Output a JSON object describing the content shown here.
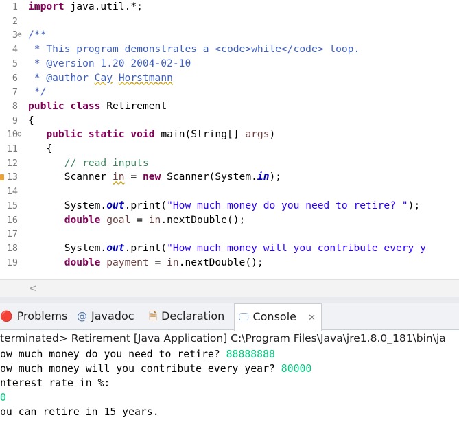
{
  "editor": {
    "lines": [
      {
        "n": "1",
        "fold": "",
        "segs": [
          {
            "t": "import",
            "c": "kw"
          },
          {
            "t": " java.util.*;"
          }
        ]
      },
      {
        "n": "2",
        "fold": "",
        "segs": []
      },
      {
        "n": "3",
        "fold": "⊖",
        "segs": [
          {
            "t": "/**",
            "c": "cm"
          }
        ]
      },
      {
        "n": "4",
        "fold": "",
        "segs": [
          {
            "t": " * This program demonstrates a <code>while</code> loop.",
            "c": "cm"
          }
        ]
      },
      {
        "n": "5",
        "fold": "",
        "segs": [
          {
            "t": " * @version 1.20 2004-02-10",
            "c": "cm"
          }
        ]
      },
      {
        "n": "6",
        "fold": "",
        "segs": [
          {
            "t": " * @author ",
            "c": "cm"
          },
          {
            "t": "Cay",
            "c": "cm sq"
          },
          {
            "t": " ",
            "c": "cm"
          },
          {
            "t": "Horstmann",
            "c": "cm sq"
          }
        ]
      },
      {
        "n": "7",
        "fold": "",
        "segs": [
          {
            "t": " */",
            "c": "cm"
          }
        ]
      },
      {
        "n": "8",
        "fold": "",
        "segs": [
          {
            "t": "public",
            "c": "kw"
          },
          {
            "t": " "
          },
          {
            "t": "class",
            "c": "kw"
          },
          {
            "t": " Retirement"
          }
        ]
      },
      {
        "n": "9",
        "fold": "",
        "segs": [
          {
            "t": "{"
          }
        ]
      },
      {
        "n": "10",
        "fold": "⊖",
        "segs": [
          {
            "t": "   "
          },
          {
            "t": "public",
            "c": "kw"
          },
          {
            "t": " "
          },
          {
            "t": "static",
            "c": "kw"
          },
          {
            "t": " "
          },
          {
            "t": "void",
            "c": "kw"
          },
          {
            "t": " main(String[] "
          },
          {
            "t": "args",
            "c": "var"
          },
          {
            "t": ")"
          }
        ]
      },
      {
        "n": "11",
        "fold": "",
        "segs": [
          {
            "t": "   {"
          }
        ]
      },
      {
        "n": "12",
        "fold": "",
        "segs": [
          {
            "t": "      "
          },
          {
            "t": "// read inputs",
            "c": "lc"
          }
        ]
      },
      {
        "n": "13",
        "fold": "",
        "marker": true,
        "segs": [
          {
            "t": "      Scanner "
          },
          {
            "t": "in",
            "c": "var sq"
          },
          {
            "t": " = "
          },
          {
            "t": "new",
            "c": "kw"
          },
          {
            "t": " Scanner(System."
          },
          {
            "t": "in",
            "c": "fld"
          },
          {
            "t": ");"
          }
        ]
      },
      {
        "n": "14",
        "fold": "",
        "segs": []
      },
      {
        "n": "15",
        "fold": "",
        "segs": [
          {
            "t": "      System."
          },
          {
            "t": "out",
            "c": "fld"
          },
          {
            "t": ".print("
          },
          {
            "t": "\"How much money do you need to retire? \"",
            "c": "str"
          },
          {
            "t": ");"
          }
        ]
      },
      {
        "n": "16",
        "fold": "",
        "segs": [
          {
            "t": "      "
          },
          {
            "t": "double",
            "c": "kw"
          },
          {
            "t": " "
          },
          {
            "t": "goal",
            "c": "var"
          },
          {
            "t": " = "
          },
          {
            "t": "in",
            "c": "var"
          },
          {
            "t": ".nextDouble();"
          }
        ]
      },
      {
        "n": "17",
        "fold": "",
        "segs": []
      },
      {
        "n": "18",
        "fold": "",
        "segs": [
          {
            "t": "      System."
          },
          {
            "t": "out",
            "c": "fld"
          },
          {
            "t": ".print("
          },
          {
            "t": "\"How much money will you contribute every y",
            "c": "str"
          }
        ]
      },
      {
        "n": "19",
        "fold": "",
        "segs": [
          {
            "t": "      "
          },
          {
            "t": "double",
            "c": "kw"
          },
          {
            "t": " "
          },
          {
            "t": "payment",
            "c": "var"
          },
          {
            "t": " = "
          },
          {
            "t": "in",
            "c": "var"
          },
          {
            "t": ".nextDouble();"
          }
        ]
      }
    ],
    "scroll_left_arrow": "<"
  },
  "tabs": [
    {
      "label": "Problems",
      "icon": "problems-icon",
      "glyph": "🔴",
      "icon_color": "#c0392b"
    },
    {
      "label": "Javadoc",
      "icon": "javadoc-icon",
      "glyph": "@",
      "icon_color": "#4a6fa5"
    },
    {
      "label": "Declaration",
      "icon": "declaration-icon",
      "glyph": "🗎",
      "icon_color": "#c77b20"
    },
    {
      "label": "Console",
      "icon": "console-icon",
      "glyph": "🖵",
      "icon_color": "#2c5aa0",
      "active": true,
      "close": "✕"
    }
  ],
  "console": {
    "header": "terminated> Retirement [Java Application] C:\\Program Files\\Java\\jre1.8.0_181\\bin\\ja",
    "lines": [
      {
        "segs": [
          {
            "t": "ow much money do you need to retire? "
          },
          {
            "t": "88888888",
            "c": "inp"
          }
        ]
      },
      {
        "segs": [
          {
            "t": "ow much money will you contribute every year? "
          },
          {
            "t": "80000",
            "c": "inp"
          }
        ]
      },
      {
        "segs": [
          {
            "t": "nterest rate in %:"
          }
        ]
      },
      {
        "segs": [
          {
            "t": "0",
            "c": "inp"
          }
        ]
      },
      {
        "segs": [
          {
            "t": "ou can retire in 15 years."
          }
        ]
      }
    ]
  },
  "colors": {
    "keyword": "#7f0055",
    "comment": "#3f5fbf",
    "line_comment": "#3f7f5f",
    "string": "#2a00ff",
    "field": "#0000c0",
    "variable": "#6a3e3e",
    "console_input": "#00c87d"
  }
}
